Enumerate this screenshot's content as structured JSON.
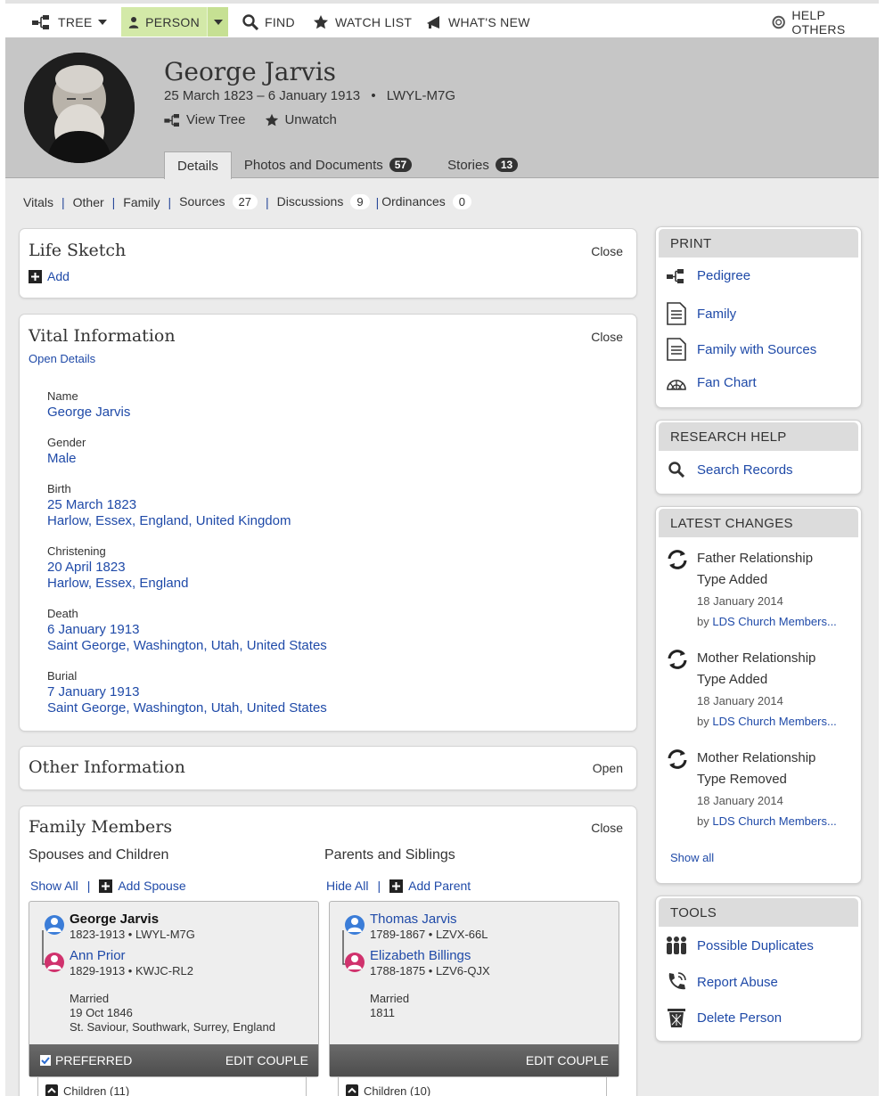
{
  "nav": {
    "tree": "TREE",
    "person": "PERSON",
    "find": "FIND",
    "watch_list": "WATCH LIST",
    "whats_new": "WHAT'S NEW",
    "help_others": "HELP OTHERS"
  },
  "person": {
    "name": "George Jarvis",
    "dates": "25 March 1823 – 6 January 1913",
    "id": "LWYL-M7G",
    "view_tree": "View Tree",
    "unwatch": "Unwatch"
  },
  "tabs": [
    {
      "label": "Details"
    },
    {
      "label": "Photos and Documents",
      "count": "57"
    },
    {
      "label": "Stories",
      "count": "13"
    }
  ],
  "subnav": [
    {
      "label": "Vitals"
    },
    {
      "label": "Other"
    },
    {
      "label": "Family"
    },
    {
      "label": "Sources",
      "count": "27"
    },
    {
      "label": "Discussions",
      "count": "9"
    },
    {
      "label": "Ordinances",
      "count": "0"
    }
  ],
  "life_sketch": {
    "title": "Life Sketch",
    "action": "Close",
    "add": "Add"
  },
  "vital": {
    "title": "Vital Information",
    "action": "Close",
    "open_details": "Open Details",
    "name_label": "Name",
    "name": "George Jarvis",
    "gender_label": "Gender",
    "gender": "Male",
    "birth_label": "Birth",
    "birth_date": "25 March 1823",
    "birth_place": "Harlow, Essex, England, United Kingdom",
    "christening_label": "Christening",
    "christening_date": "20 April 1823",
    "christening_place": "Harlow, Essex, England",
    "death_label": "Death",
    "death_date": "6 January 1913",
    "death_place": "Saint George, Washington, Utah, United States",
    "burial_label": "Burial",
    "burial_date": "7 January 1913",
    "burial_place": "Saint George, Washington, Utah, United States"
  },
  "other_info": {
    "title": "Other Information",
    "action": "Open"
  },
  "family": {
    "title": "Family Members",
    "action": "Close",
    "spouses_title": "Spouses and Children",
    "parents_title": "Parents and Siblings",
    "show_all": "Show All",
    "add_spouse": "Add Spouse",
    "hide_all": "Hide All",
    "add_parent": "Add Parent",
    "couple1": {
      "husband": "George Jarvis",
      "husband_info": "1823-1913  •  LWYL-M7G",
      "wife": "Ann Prior",
      "wife_info": "1829-1913  •  KWJC-RL2",
      "married": "Married",
      "date": "19 Oct 1846",
      "place": "St. Saviour, Southwark, Surrey, England",
      "preferred": "PREFERRED",
      "edit": "EDIT COUPLE",
      "children": "Children (11)"
    },
    "couple2": {
      "husband": "Thomas Jarvis",
      "husband_info": "1789-1867  •  LZVX-66L",
      "wife": "Elizabeth Billings",
      "wife_info": "1788-1875  •  LZV6-QJX",
      "married": "Married",
      "date": "1811",
      "edit": "EDIT COUPLE",
      "children": "Children (10)"
    }
  },
  "print": {
    "title": "PRINT",
    "items": [
      "Pedigree",
      "Family",
      "Family with Sources",
      "Fan Chart"
    ]
  },
  "research": {
    "title": "RESEARCH HELP",
    "search": "Search Records"
  },
  "changes": {
    "title": "LATEST CHANGES",
    "items": [
      {
        "line1": "Father Relationship",
        "line2": "Type Added",
        "date": "18 January 2014",
        "by": "by",
        "who": "LDS Church Members..."
      },
      {
        "line1": "Mother Relationship",
        "line2": "Type Added",
        "date": "18 January 2014",
        "by": "by",
        "who": "LDS Church Members..."
      },
      {
        "line1": "Mother Relationship",
        "line2": "Type Removed",
        "date": "18 January 2014",
        "by": "by",
        "who": "LDS Church Members..."
      }
    ],
    "show_all": "Show all"
  },
  "tools": {
    "title": "TOOLS",
    "items": [
      "Possible Duplicates",
      "Report Abuse",
      "Delete Person"
    ]
  },
  "colors": {
    "link": "#1f4aa8",
    "person_tab": "#d3e9a8",
    "header_bg": "#c6c6c6",
    "male": "#3b7dd8",
    "female": "#d0326d"
  }
}
